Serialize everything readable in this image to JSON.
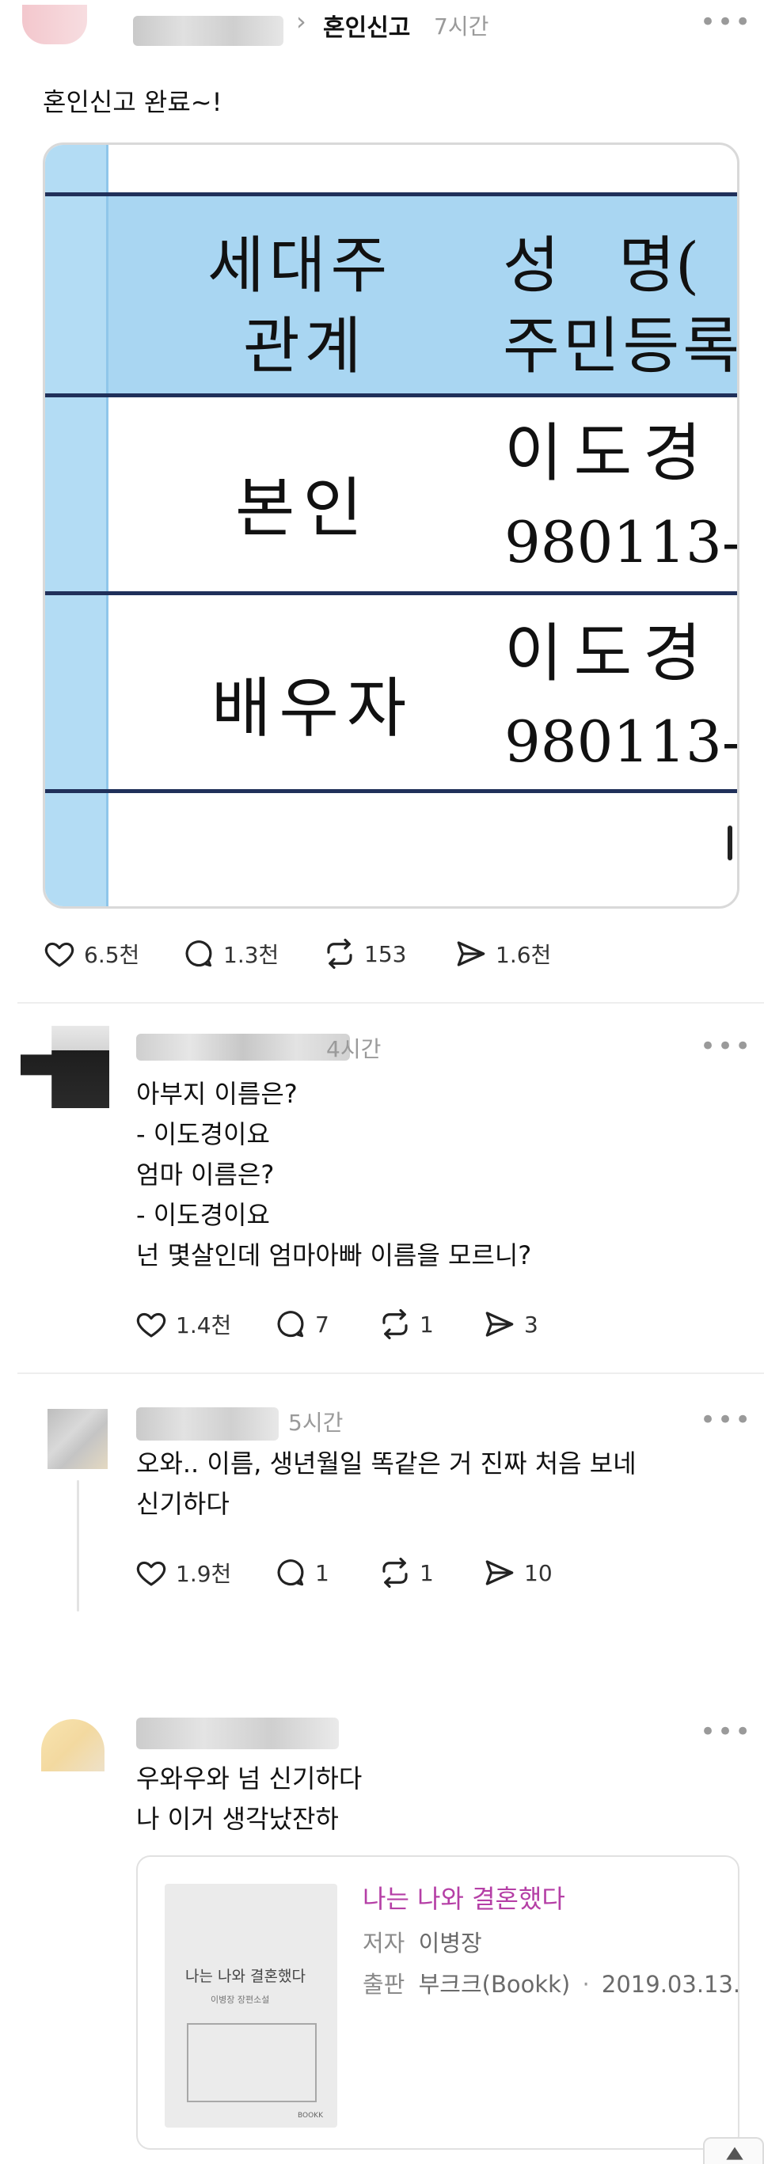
{
  "post": {
    "breadcrumb_chevron": "›",
    "topic": "혼인신고",
    "time": "7시간",
    "more": "•••",
    "text": "혼인신고 완료~!",
    "image": {
      "header_col1_line1": "세대주",
      "header_col1_line2": "관계",
      "header_col2_line1": "성   명(",
      "header_col2_line2": "주민등록",
      "row1_relation": "본인",
      "row1_name": "이도경",
      "row1_id": "980113-",
      "row2_relation": "배우자",
      "row2_name": "이도경",
      "row2_id": "980113-"
    },
    "actions": {
      "likes": "6.5천",
      "comments": "1.3천",
      "reposts": "153",
      "shares": "1.6천"
    }
  },
  "replies": [
    {
      "time": "4시간",
      "more": "•••",
      "text": "아부지 이름은?\n- 이도경이요\n엄마 이름은?\n- 이도경이요\n넌 몇살인데 엄마아빠 이름을 모르니?",
      "actions": {
        "likes": "1.4천",
        "comments": "7",
        "reposts": "1",
        "shares": "3"
      }
    },
    {
      "time": "5시간",
      "more": "•••",
      "text": "오와.. 이름, 생년월일 똑같은 거 진짜 처음 보네\n신기하다",
      "actions": {
        "likes": "1.9천",
        "comments": "1",
        "reposts": "1",
        "shares": "10"
      }
    },
    {
      "more": "•••",
      "text": "우와우와 넘 신기하다\n나 이거 생각났잔하",
      "book": {
        "cover_title": "나는 나와 결혼했다",
        "cover_author": "이병장 장편소설",
        "cover_publisher": "BOOKK",
        "title": "나는 나와 결혼했다",
        "author_label": "저자",
        "author": "이병장",
        "publisher_label": "출판",
        "publisher": "부크크(Bookk)",
        "separator": "·",
        "date": "2019.03.13."
      }
    }
  ],
  "colors": {
    "book_title": "#b53fa6",
    "meta": "#9a9a9a",
    "doc_blue": "#b3dcf4"
  }
}
